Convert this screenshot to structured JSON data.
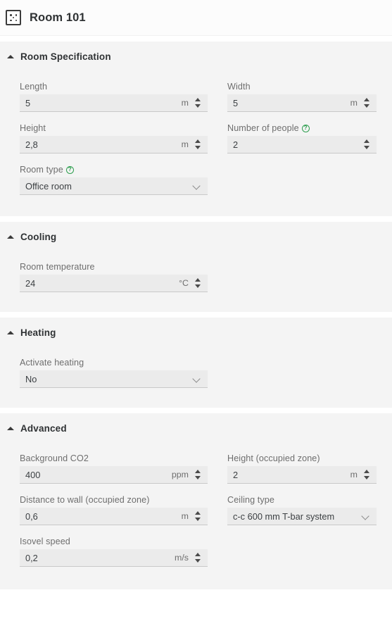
{
  "header": {
    "icon": "room-grid-icon",
    "title": "Room 101"
  },
  "sections": [
    {
      "id": "room-specification",
      "title": "Room Specification",
      "caret": "caret-up-icon",
      "fields": [
        {
          "label": "Length",
          "value": "5",
          "unit": "m",
          "type": "number",
          "help": false
        },
        {
          "label": "Width",
          "value": "5",
          "unit": "m",
          "type": "number",
          "help": false
        },
        {
          "label": "Height",
          "value": "2,8",
          "unit": "m",
          "type": "number",
          "help": false
        },
        {
          "label": "Number of people",
          "value": "2",
          "unit": "",
          "type": "number",
          "help": true
        },
        {
          "label": "Room type",
          "value": "Office room",
          "unit": "",
          "type": "select",
          "help": true
        }
      ]
    },
    {
      "id": "cooling",
      "title": "Cooling",
      "caret": "caret-up-icon",
      "fields": [
        {
          "label": "Room temperature",
          "value": "24",
          "unit": "°C",
          "type": "number",
          "help": false
        }
      ]
    },
    {
      "id": "heating",
      "title": "Heating",
      "caret": "caret-up-icon",
      "fields": [
        {
          "label": "Activate heating",
          "value": "No",
          "unit": "",
          "type": "select",
          "help": false
        }
      ]
    },
    {
      "id": "advanced",
      "title": "Advanced",
      "caret": "caret-up-icon",
      "fields": [
        {
          "label": "Background CO2",
          "value": "400",
          "unit": "ppm",
          "type": "number",
          "help": false
        },
        {
          "label": "Height (occupied zone)",
          "value": "2",
          "unit": "m",
          "type": "number",
          "help": false
        },
        {
          "label": "Distance to wall (occupied zone)",
          "value": "0,6",
          "unit": "m",
          "type": "number",
          "help": false
        },
        {
          "label": "Ceiling type",
          "value": "c-c 600 mm T-bar system",
          "unit": "",
          "type": "select",
          "help": false
        },
        {
          "label": "Isovel speed",
          "value": "0,2",
          "unit": "m/s",
          "type": "number",
          "help": false
        }
      ]
    }
  ],
  "help_glyph": "?",
  "colors": {
    "page_background": "#ffffff",
    "section_background": "#f4f4f4",
    "input_background": "#ebebeb",
    "input_underline": "#c9c9c9",
    "label_text": "#6e6e6e",
    "value_text": "#3c4043",
    "title_text": "#2f3234",
    "help_accent": "#2e9e4f"
  }
}
